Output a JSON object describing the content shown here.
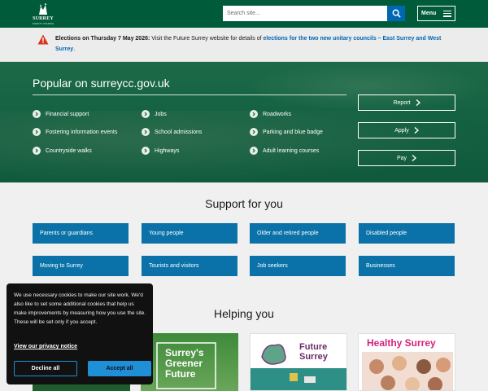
{
  "header": {
    "logo_text": "SURREY",
    "logo_sub": "COUNTY COUNCIL",
    "search_placeholder": "Search site...",
    "menu_label": "Menu"
  },
  "alert": {
    "date_text": "Elections on Thursday 7 May 2026:",
    "body_text": " Visit the Future Surrey website for details of ",
    "link_text": "elections for the two new unitary councils – East Surrey and West Surrey",
    "end_text": "."
  },
  "popular": {
    "title": "Popular on surreycc.gov.uk",
    "links": [
      "Financial support",
      "Jobs",
      "Roadworks",
      "Fostering information events",
      "School admissions",
      "Parking and blue badge",
      "Countryside walks",
      "Highways",
      "Adult learning courses"
    ],
    "buttons": [
      "Report",
      "Apply",
      "Pay"
    ]
  },
  "support": {
    "title": "Support for you",
    "tiles": [
      "Parents or guardians",
      "Young people",
      "Older and retired people",
      "Disabled people",
      "Moving to Surrey",
      "Tourists and visitors",
      "Job seekers",
      "Businesses"
    ]
  },
  "helping": {
    "title": "Helping you",
    "cards": [
      {
        "text": ""
      },
      {
        "text": "Surrey's Greener Future"
      },
      {
        "text": "Future Surrey"
      },
      {
        "text": "Healthy Surrey"
      }
    ]
  },
  "cookie": {
    "text": "We use necessary cookies to make our site work. We'd also like to set some additional cookies that help us make improvements by measuring how you use the site. These will be set only if you accept.",
    "privacy_link": "View our privacy notice",
    "decline_label": "Decline all",
    "accept_label": "Accept all"
  },
  "colors": {
    "header_green": "#005b3a",
    "tile_blue": "#0a72a9",
    "link_blue": "#0067b3",
    "accept_blue": "#1f8fd8"
  }
}
